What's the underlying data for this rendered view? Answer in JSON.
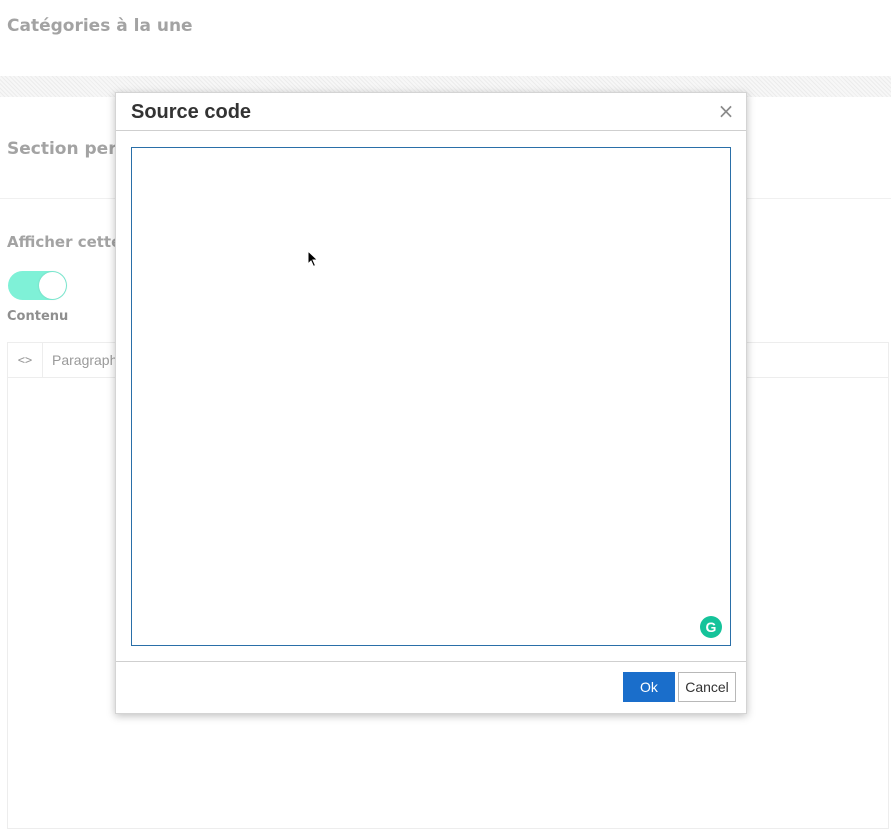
{
  "background": {
    "featured_categories_heading": "Catégories à la une",
    "custom_section_heading": "Section pers",
    "display_section_label": "Afficher cette",
    "toggle_state": "on",
    "content_label": "Contenu",
    "editor_toolbar": {
      "source_code_icon": "code-icon",
      "format_select_value": "Paragraph"
    }
  },
  "dialog": {
    "title": "Source code",
    "close_icon": "close-icon",
    "close_glyph": "×",
    "textarea_value": "",
    "grammarly_badge": "G",
    "ok_label": "Ok",
    "cancel_label": "Cancel"
  },
  "colors": {
    "toggle_on": "#7ff1d7",
    "primary_button": "#1a6ecb",
    "textarea_border": "#2a6fa8",
    "grammarly": "#15c39a"
  }
}
